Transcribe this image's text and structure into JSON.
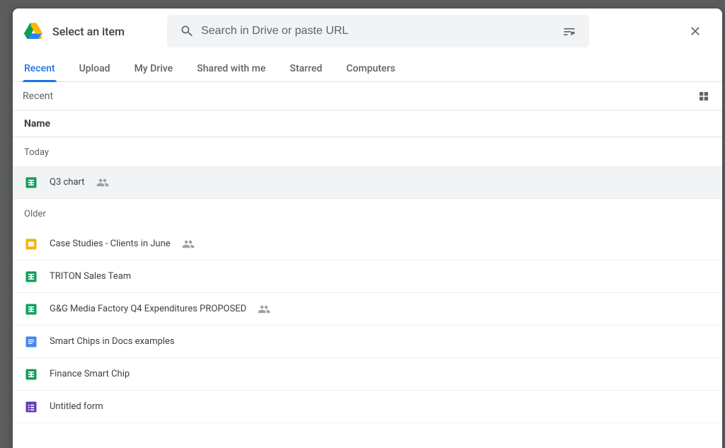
{
  "dialog": {
    "title": "Select an item",
    "search_placeholder": "Search in Drive or paste URL"
  },
  "tabs": [
    {
      "id": "recent",
      "label": "Recent",
      "active": true
    },
    {
      "id": "upload",
      "label": "Upload",
      "active": false
    },
    {
      "id": "my-drive",
      "label": "My Drive",
      "active": false
    },
    {
      "id": "shared-with-me",
      "label": "Shared with me",
      "active": false
    },
    {
      "id": "starred",
      "label": "Starred",
      "active": false
    },
    {
      "id": "computers",
      "label": "Computers",
      "active": false
    }
  ],
  "breadcrumb": "Recent",
  "column_header": "Name",
  "sections": [
    {
      "label": "Today",
      "items": [
        {
          "type": "sheets",
          "name": "Q3 chart",
          "shared": true,
          "selected": true
        }
      ]
    },
    {
      "label": "Older",
      "items": [
        {
          "type": "slides",
          "name": "Case Studies - Clients in June",
          "shared": true,
          "selected": false
        },
        {
          "type": "sheets",
          "name": "TRITON Sales Team",
          "shared": false,
          "selected": false
        },
        {
          "type": "sheets",
          "name": "G&G Media Factory Q4 Expenditures PROPOSED",
          "shared": true,
          "selected": false
        },
        {
          "type": "docs",
          "name": "Smart Chips in Docs examples",
          "shared": false,
          "selected": false
        },
        {
          "type": "sheets",
          "name": "Finance Smart Chip",
          "shared": false,
          "selected": false
        },
        {
          "type": "forms",
          "name": "Untitled form",
          "shared": false,
          "selected": false
        }
      ]
    }
  ],
  "icons": {
    "sheets_color": "#0f9d58",
    "slides_color": "#f4b400",
    "docs_color": "#4285f4",
    "forms_color": "#673ab7"
  }
}
